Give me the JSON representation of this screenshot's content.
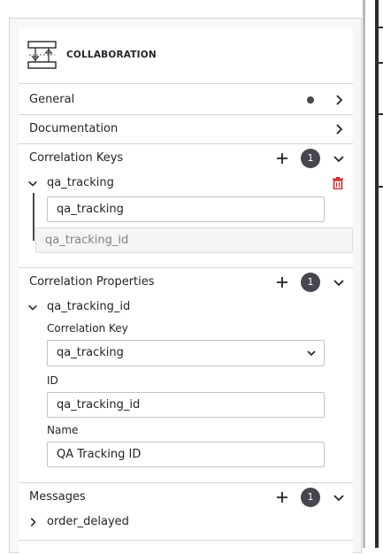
{
  "header": {
    "title": "COLLABORATION",
    "icon": "collaboration-icon"
  },
  "sections": {
    "general": {
      "label": "General"
    },
    "documentation": {
      "label": "Documentation"
    },
    "correlation_keys": {
      "label": "Correlation Keys",
      "count": "1",
      "item": {
        "label": "qa_tracking",
        "name_value": "qa_tracking",
        "property_value": "qa_tracking_id"
      }
    },
    "correlation_properties": {
      "label": "Correlation Properties",
      "count": "1",
      "item": {
        "label": "qa_tracking_id",
        "key_label": "Correlation Key",
        "key_value": "qa_tracking",
        "id_label": "ID",
        "id_value": "qa_tracking_id",
        "name_label": "Name",
        "name_value": "QA Tracking ID"
      }
    },
    "messages": {
      "label": "Messages",
      "count": "1",
      "item": {
        "label": "order_delayed"
      }
    }
  },
  "colors": {
    "text": "#22242a",
    "badge": "#45464e",
    "delete": "#cc2b2b",
    "border": "#d4d4d8"
  }
}
